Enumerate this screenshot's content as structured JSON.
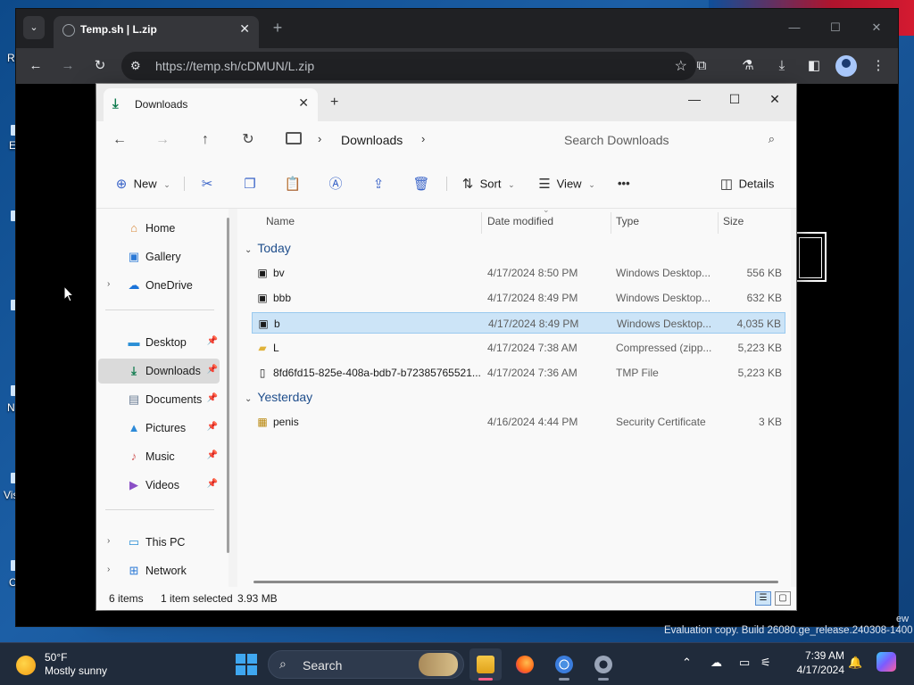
{
  "desktop": {
    "fragments": [
      "Re",
      "E",
      "N",
      "Vis",
      "C"
    ],
    "watermark": "Evaluation copy. Build 26080.ge_release.240308-1400",
    "watermark_frag": "ew"
  },
  "browser": {
    "tab_title": "Temp.sh | L.zip",
    "url": "https://temp.sh/cDMUN/L.zip",
    "icons": {
      "tab_search": "chevron-down-icon",
      "back": "back-arrow-icon",
      "forward": "forward-arrow-icon",
      "reload": "reload-icon",
      "site_info": "tune-icon",
      "bookmark": "star-icon",
      "extensions": "puzzle-icon",
      "labs": "flask-icon",
      "downloads": "download-icon",
      "side_panel": "side-panel-icon",
      "profile": "avatar-icon",
      "menu": "kebab-menu-icon"
    }
  },
  "explorer": {
    "tab_title": "Downloads",
    "breadcrumb": "Downloads",
    "search_placeholder": "Search Downloads",
    "toolbar": {
      "new": "New",
      "sort": "Sort",
      "view": "View",
      "more": "•••",
      "details": "Details"
    },
    "sidebar": {
      "top": [
        {
          "label": "Home",
          "icon": "home-icon",
          "expandable": false
        },
        {
          "label": "Gallery",
          "icon": "gallery-icon",
          "expandable": false
        },
        {
          "label": "OneDrive",
          "icon": "cloud-icon",
          "expandable": true
        }
      ],
      "pinned": [
        {
          "label": "Desktop",
          "icon": "desktop-icon"
        },
        {
          "label": "Downloads",
          "icon": "download-icon",
          "selected": true
        },
        {
          "label": "Documents",
          "icon": "document-icon"
        },
        {
          "label": "Pictures",
          "icon": "pictures-icon"
        },
        {
          "label": "Music",
          "icon": "music-icon"
        },
        {
          "label": "Videos",
          "icon": "videos-icon"
        }
      ],
      "bottom": [
        {
          "label": "This PC",
          "icon": "pc-icon"
        },
        {
          "label": "Network",
          "icon": "network-icon"
        }
      ]
    },
    "columns": {
      "name": "Name",
      "date": "Date modified",
      "type": "Type",
      "size": "Size"
    },
    "groups": [
      {
        "label": "Today",
        "files": [
          {
            "name": "bv",
            "date": "4/17/2024 8:50 PM",
            "type": "Windows Desktop...",
            "size": "556 KB",
            "icon": "shortcut-file-icon"
          },
          {
            "name": "bbb",
            "date": "4/17/2024 8:49 PM",
            "type": "Windows Desktop...",
            "size": "632 KB",
            "icon": "shortcut-file-icon"
          },
          {
            "name": "b",
            "date": "4/17/2024 8:49 PM",
            "type": "Windows Desktop...",
            "size": "4,035 KB",
            "icon": "shortcut-file-icon",
            "selected": true
          },
          {
            "name": "L",
            "date": "4/17/2024 7:38 AM",
            "type": "Compressed (zipp...",
            "size": "5,223 KB",
            "icon": "zip-folder-icon"
          },
          {
            "name": "8fd6fd15-825e-408a-bdb7-b72385765521....",
            "date": "4/17/2024 7:36 AM",
            "type": "TMP File",
            "size": "5,223 KB",
            "icon": "file-icon"
          }
        ]
      },
      {
        "label": "Yesterday",
        "files": [
          {
            "name": "penis",
            "date": "4/16/2024 4:44 PM",
            "type": "Security Certificate",
            "size": "3 KB",
            "icon": "certificate-icon"
          }
        ]
      }
    ],
    "status": {
      "count": "6 items",
      "selected": "1 item selected",
      "size": "3.93 MB"
    }
  },
  "taskbar": {
    "weather_temp": "50°F",
    "weather_desc": "Mostly sunny",
    "search_label": "Search",
    "time": "7:39 AM",
    "date": "4/17/2024",
    "apps": [
      "file-explorer-icon",
      "firefox-icon",
      "chrome-icon",
      "settings-icon"
    ]
  }
}
